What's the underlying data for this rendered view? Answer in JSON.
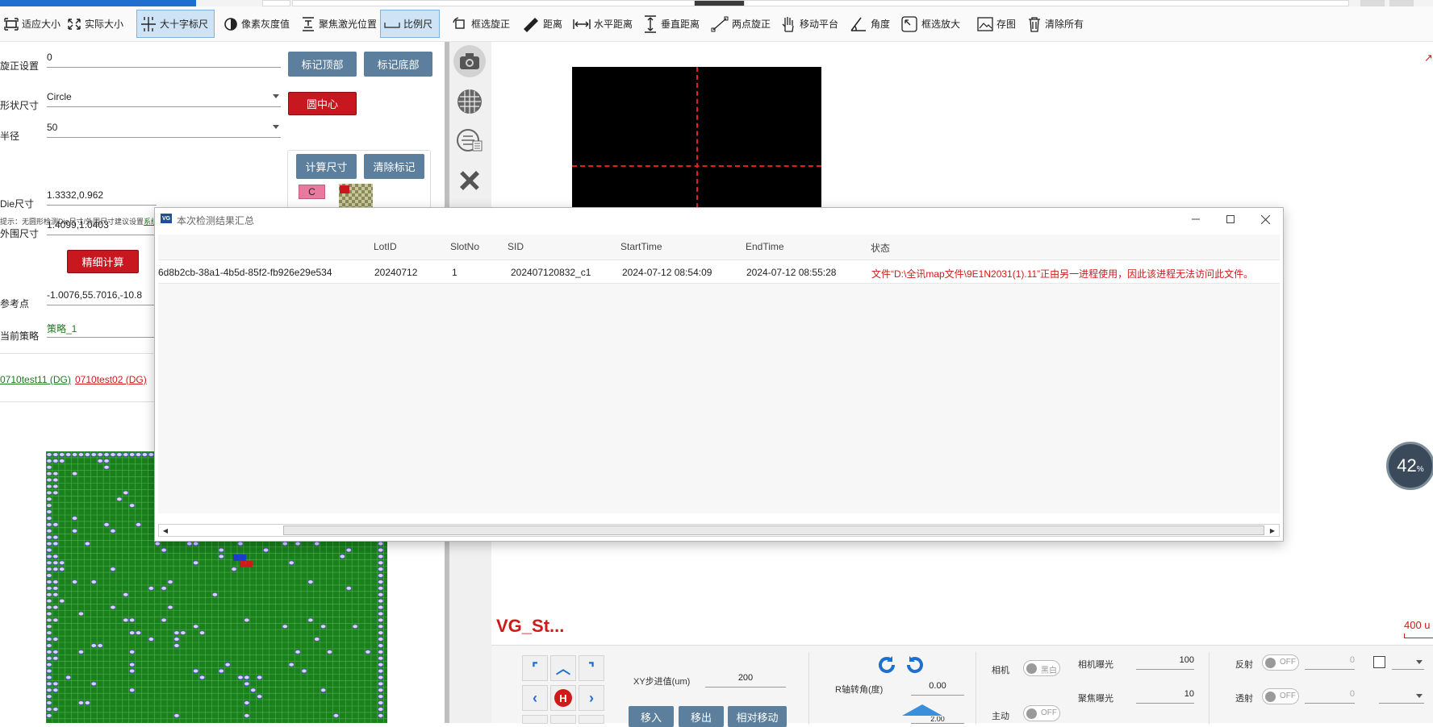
{
  "toolbar": {
    "items": [
      {
        "label": "适应大小",
        "icon": "fit-screen-icon"
      },
      {
        "label": "实际大小",
        "icon": "actual-size-icon"
      },
      {
        "label": "大十字标尺",
        "icon": "crosshair-ruler-icon"
      },
      {
        "label": "像素灰度值",
        "icon": "grayscale-icon"
      },
      {
        "label": "聚焦激光位置",
        "icon": "laser-focus-icon"
      },
      {
        "label": "比例尺",
        "icon": "scale-bar-icon"
      },
      {
        "label": "框选旋正",
        "icon": "rotate-select-icon"
      },
      {
        "label": "距离",
        "icon": "ruler-icon"
      },
      {
        "label": "水平距离",
        "icon": "horizontal-distance-icon"
      },
      {
        "label": "垂直距离",
        "icon": "vertical-distance-icon"
      },
      {
        "label": "两点旋正",
        "icon": "two-point-rotate-icon"
      },
      {
        "label": "移动平台",
        "icon": "hand-move-icon"
      },
      {
        "label": "角度",
        "icon": "angle-icon"
      },
      {
        "label": "框选放大",
        "icon": "zoom-select-icon"
      },
      {
        "label": "存图",
        "icon": "save-image-icon"
      },
      {
        "label": "清除所有",
        "icon": "trash-icon"
      }
    ]
  },
  "left": {
    "rotation_label": "旋正设置",
    "rotation_value": "0",
    "mark_top": "标记顶部",
    "mark_bottom": "标记底部",
    "shape_label": "形状尺寸",
    "shape_value": "Circle",
    "circle_center": "圆中心",
    "radius_label": "半径",
    "radius_value": "50",
    "calc_size": "计算尺寸",
    "clear_marks": "清除标记",
    "hint_text": "提示：无圆形检测Die尺寸/外围尺寸建议设置",
    "hint_link": "系统计算值",
    "die_label": "Die尺寸",
    "die_value": "1.3332,0.962",
    "outer_label": "外围尺寸",
    "outer_value": "1.4099,1.0403",
    "fine_calc": "精细计算",
    "ref_label": "参考点",
    "ref_value": "-1.0076,55.7016,-10.8",
    "strategy_label": "当前策略",
    "strategy_value": "策略_1",
    "tag_c": "C",
    "recipe_a": "0710test11 (DG)",
    "recipe_b": "0710test02 (DG)"
  },
  "camera": {
    "title": "VG_St...",
    "scale": "400 u"
  },
  "badge": {
    "value": "42",
    "unit": "%"
  },
  "controls": {
    "xy_step_label": "XY步进值(um)",
    "xy_step_value": "200",
    "r_angle_label": "R轴转角(度)",
    "r_angle_value": "0.00",
    "z_step_value": "2.00",
    "move_in": "移入",
    "move_out": "移出",
    "relative_move": "相对移动",
    "home": "H",
    "camera_label": "相机",
    "camera_toggle": "黑白",
    "active_label": "主动",
    "active_toggle": "OFF",
    "cam_exposure_label": "相机曝光",
    "cam_exposure_value": "100",
    "focus_exposure_label": "聚焦曝光",
    "focus_exposure_value": "10",
    "reflect_label": "反射",
    "reflect_toggle": "OFF",
    "reflect_value": "0",
    "transmit_label": "透射",
    "transmit_toggle": "OFF",
    "transmit_value": "0"
  },
  "dialog": {
    "title": "本次检测结果汇总",
    "app_icon": "VG",
    "columns": [
      "LotID",
      "SlotNo",
      "SID",
      "StartTime",
      "EndTime",
      "状态"
    ],
    "rows": [
      {
        "id": "6d8b2cb-38a1-4b5d-85f2-fb926e29e534",
        "lot": "20240712",
        "slot": "1",
        "sid": "202407120832_c1",
        "start": "2024-07-12 08:54:09",
        "end": "2024-07-12 08:55:28",
        "status": "文件“D:\\全讯map文件\\9E1N2031(1).11”正由另一进程使用，因此该进程无法访问此文件。"
      }
    ]
  },
  "colors": {
    "accent": "#1e6fd0",
    "danger": "#c8171e",
    "button": "#5b7f9c",
    "wafer_green": "#19801c",
    "error_text": "#d01a1a"
  }
}
